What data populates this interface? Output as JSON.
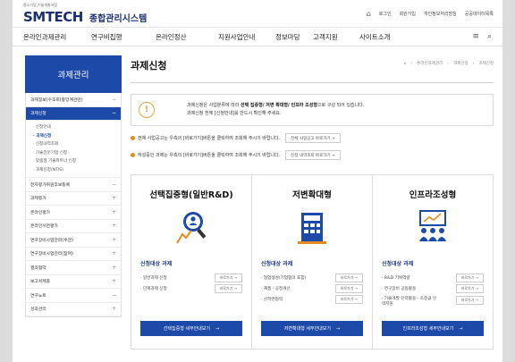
{
  "header": {
    "logo_main": "SMTECH",
    "logo_kr": "종합관리시스템",
    "logo_sub": "중소기업 기술개발사업",
    "util_links": [
      "로그인",
      "회원가입",
      "개인정보처리방침",
      "공공데이터목록"
    ]
  },
  "nav": {
    "items": [
      "온라인과제관리",
      "연구비집행",
      "온라인정산",
      "지원사업안내",
      "정보마당",
      "고객지원",
      "사이트소개"
    ]
  },
  "sidebar": {
    "title": "과제관리",
    "items": [
      {
        "label": "과제정보(수조회(중앙계관련)",
        "pm": "−",
        "active": false
      },
      {
        "label": "과제신청",
        "pm": "−",
        "active": true
      }
    ],
    "sub_items": [
      "· 신청안내",
      "· 과제신청",
      "· 신청내역조회",
      "· 기술전문기업 신청",
      "· 맞춤형 기술파트너 신청",
      "· 과제신청(NTIS)"
    ],
    "sub_active": 1,
    "rest": [
      {
        "label": "전자평가위원후보등록",
        "pm": "−"
      },
      {
        "label": "과제평가",
        "pm": "+"
      },
      {
        "label": "온라인평가",
        "pm": "+"
      },
      {
        "label": "온라인서면평가",
        "pm": "+"
      },
      {
        "label": "연구장비사업관리(주관)",
        "pm": "+"
      },
      {
        "label": "연구장비사업관리(참여)",
        "pm": "+"
      },
      {
        "label": "결과협약",
        "pm": "+"
      },
      {
        "label": "보고서제출",
        "pm": "+"
      },
      {
        "label": "연구노트",
        "pm": "−"
      },
      {
        "label": "성과관리",
        "pm": "+"
      }
    ]
  },
  "main": {
    "title": "과제신청",
    "breadcrumb": [
      "온라인과제관리",
      "과제신청",
      "과제신청"
    ],
    "notice_line1_pre": "과제신청은 사업분류에 따라 ",
    "notice_line1_bold": "선택 집중형/ 저변 확대형/ 인프라 조성형",
    "notice_line1_post": "으로 구성 되어 있습니다.",
    "notice_line2": "과제신청 전에 [신청안내]를 반드시 확인해 주세요.",
    "guides": [
      {
        "text": "전체 사업공고는 우측의 [바로가기]버튼을 클릭하여 조회해 주시기 바랍니다.",
        "button": "전체 사업공고 바로가기 →"
      },
      {
        "text": "작성중인 과제는 우측의 [바로가기]버튼을 클릭하여 조회해 주시기 바랍니다.",
        "button": "신청 내역조회 바로가기 →"
      }
    ],
    "cards": [
      {
        "title": "선택집중형(일반R&D)",
        "subtitle": "신청대상 과제",
        "items": [
          {
            "label": "· 일반과제 신청",
            "button": "바로가기 →"
          },
          {
            "label": "· 단계과제 신청",
            "button": "바로가기 →"
          }
        ],
        "cta": "선택집중형 세부안내보기"
      },
      {
        "title": "저변확대형",
        "subtitle": "신청대상 과제",
        "items": [
          {
            "label": "· 협업생성(기업협의 포함)",
            "button": "바로가기 →"
          },
          {
            "label": "· 제품 · 공정개선",
            "button": "바로가기 →"
          },
          {
            "label": "· 산학연협력",
            "button": "바로가기 →"
          }
        ],
        "cta": "저변확대형 세부안내보기"
      },
      {
        "title": "인프라조성형",
        "subtitle": "신청대상 과제",
        "items": [
          {
            "label": "· R&D 기획역량",
            "button": "바로가기 →"
          },
          {
            "label": "· 연구장비 공동활용",
            "button": "바로가기 →"
          },
          {
            "label": "· 기술개발 인력활용 - 초중급 인력지원",
            "button": "바로가기 →"
          }
        ],
        "cta": "인프라조성형 세부안내보기"
      }
    ],
    "arrow": "→"
  },
  "colors": {
    "brand_blue": "#1d4aa8",
    "accent_orange": "#e58a1f"
  }
}
